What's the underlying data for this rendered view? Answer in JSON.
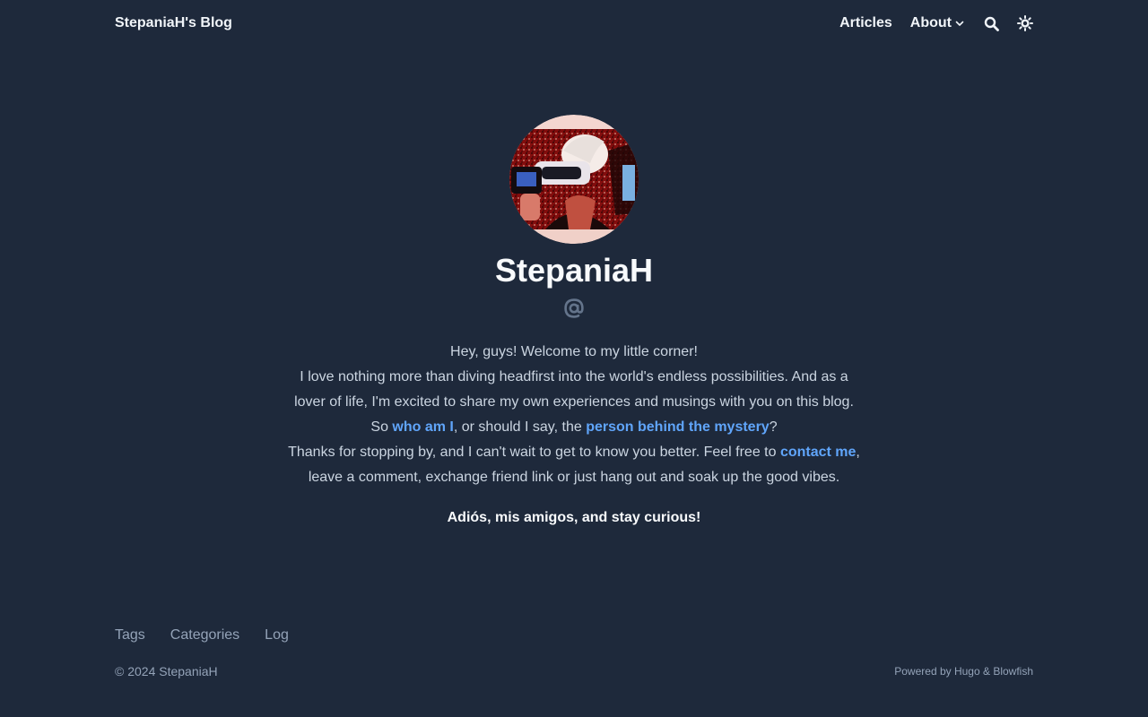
{
  "header": {
    "site_title": "StepaniaH's Blog",
    "nav": {
      "articles": "Articles",
      "about": "About"
    },
    "icons": [
      "search-icon",
      "theme-toggle-icon",
      "chevron-down-icon"
    ]
  },
  "profile": {
    "name": "StepaniaH",
    "contact_icon": "at-icon",
    "bio": {
      "line1": "Hey, guys! Welcome to my little corner!",
      "line2": "I love nothing more than diving headfirst into the world's endless possibilities. And as a",
      "line3": "lover of life, I'm excited to share my own experiences and musings with you on this blog.",
      "line4_prefix": "So ",
      "link_who": "who am I",
      "line4_middle": ", or should I say, the ",
      "link_person": "person behind the mystery",
      "line4_suffix": "?",
      "line5_prefix": "Thanks for stopping by, and I can't wait to get to know you better. Feel free to ",
      "link_contact": "contact me",
      "line5_suffix": ",",
      "line6": "leave a comment, exchange friend link or just hang out and soak up the good vibes."
    },
    "signoff": "Adiós, mis amigos, and stay curious!"
  },
  "footer": {
    "links": {
      "tags": "Tags",
      "categories": "Categories",
      "log": "Log"
    },
    "copyright": "© 2024 StepaniaH",
    "powered_prefix": "Powered by ",
    "hugo": "Hugo",
    "amp": " & ",
    "blowfish": "Blowfish"
  },
  "colors": {
    "background": "#1e293b",
    "accent_link": "#60a5fa",
    "heading": "#f8fafc"
  }
}
